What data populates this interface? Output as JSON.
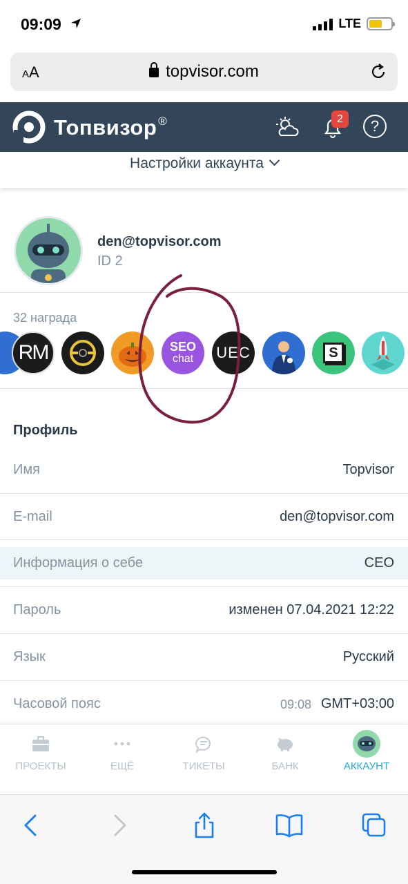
{
  "status": {
    "time": "09:09",
    "network": "LTE"
  },
  "browser": {
    "text_size": "AA",
    "url": "topvisor.com"
  },
  "header": {
    "brand": "Топвизор",
    "registered": "®",
    "notifications_count": "2",
    "help": "?"
  },
  "settings_menu": {
    "label": "Настройки аккаунта"
  },
  "user": {
    "email": "den@topvisor.com",
    "id": "ID 2"
  },
  "awards": {
    "count_label": "32 награда",
    "items": [
      {
        "name": "rm",
        "text": "RM",
        "bg": "#1b1b1b"
      },
      {
        "name": "ring",
        "text": "",
        "bg": "#1b1b1b"
      },
      {
        "name": "pumpkin",
        "text": "",
        "bg": "#f29a26"
      },
      {
        "name": "seo-chat",
        "text": "SEO chat",
        "bg": "#9a55e0"
      },
      {
        "name": "uec",
        "text": "UEC",
        "bg": "#1b1b1b"
      },
      {
        "name": "agent",
        "text": "",
        "bg": "#2f6fd1"
      },
      {
        "name": "s-box",
        "text": "S",
        "bg": "#3cc47c"
      },
      {
        "name": "rocket",
        "text": "",
        "bg": "#5fd6d0"
      }
    ]
  },
  "profile": {
    "title": "Профиль",
    "rows": [
      {
        "label": "Имя",
        "value": "Topvisor"
      },
      {
        "label": "E-mail",
        "value": "den@topvisor.com"
      },
      {
        "label": "Информация о себе",
        "value": "CEO"
      },
      {
        "label": "Пароль",
        "value": "изменен 07.04.2021 12:22"
      },
      {
        "label": "Язык",
        "value": "Русский"
      },
      {
        "label": "Часовой пояс",
        "value": "GMT+03:00",
        "sub": "09:08"
      }
    ]
  },
  "tabs": [
    {
      "label": "ПРОЕКТЫ",
      "icon": "briefcase-icon"
    },
    {
      "label": "ЕЩЁ",
      "icon": "dots-icon"
    },
    {
      "label": "ТИКЕТЫ",
      "icon": "chat-icon"
    },
    {
      "label": "БАНК",
      "icon": "piggy-bank-icon"
    },
    {
      "label": "АККАУНТ",
      "icon": "avatar"
    }
  ],
  "colors": {
    "header_bg": "#334659",
    "accent": "#29a6d4",
    "badge": "#e5473f",
    "annotation": "#7a1f3d"
  }
}
